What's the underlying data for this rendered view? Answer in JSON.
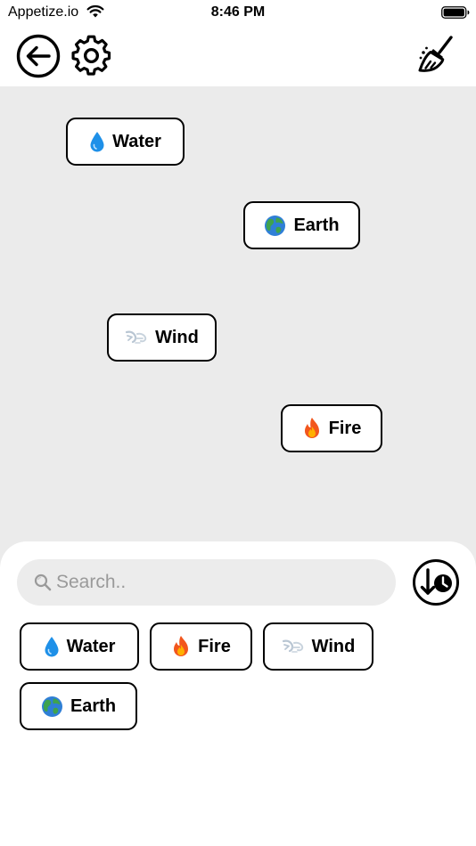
{
  "status_bar": {
    "carrier": "Appetize.io",
    "time": "8:46 PM"
  },
  "toolbar": {
    "icons": [
      "back-arrow-icon",
      "gear-icon",
      "broom-icon"
    ]
  },
  "workspace": {
    "elements": [
      {
        "emoji": "💧",
        "label": "Water"
      },
      {
        "emoji": "🌍",
        "label": "Earth"
      },
      {
        "emoji": "🌬️",
        "label": "Wind"
      },
      {
        "emoji": "🔥",
        "label": "Fire"
      }
    ]
  },
  "search": {
    "placeholder": "Search..",
    "value": ""
  },
  "inventory": {
    "items": [
      {
        "emoji": "💧",
        "label": "Water"
      },
      {
        "emoji": "🔥",
        "label": "Fire"
      },
      {
        "emoji": "🌬️",
        "label": "Wind"
      },
      {
        "emoji": "🌍",
        "label": "Earth"
      }
    ]
  },
  "colors": {
    "workspace_bg": "#ebebeb",
    "search_bg": "#ececec",
    "chip_border": "#000000",
    "water": "#1e90e8",
    "earth_ocean": "#2f7fd6",
    "earth_land": "#3fa34d",
    "fire_outer": "#f2561d",
    "fire_inner": "#ffb000",
    "wind": "#b9c6d3"
  }
}
